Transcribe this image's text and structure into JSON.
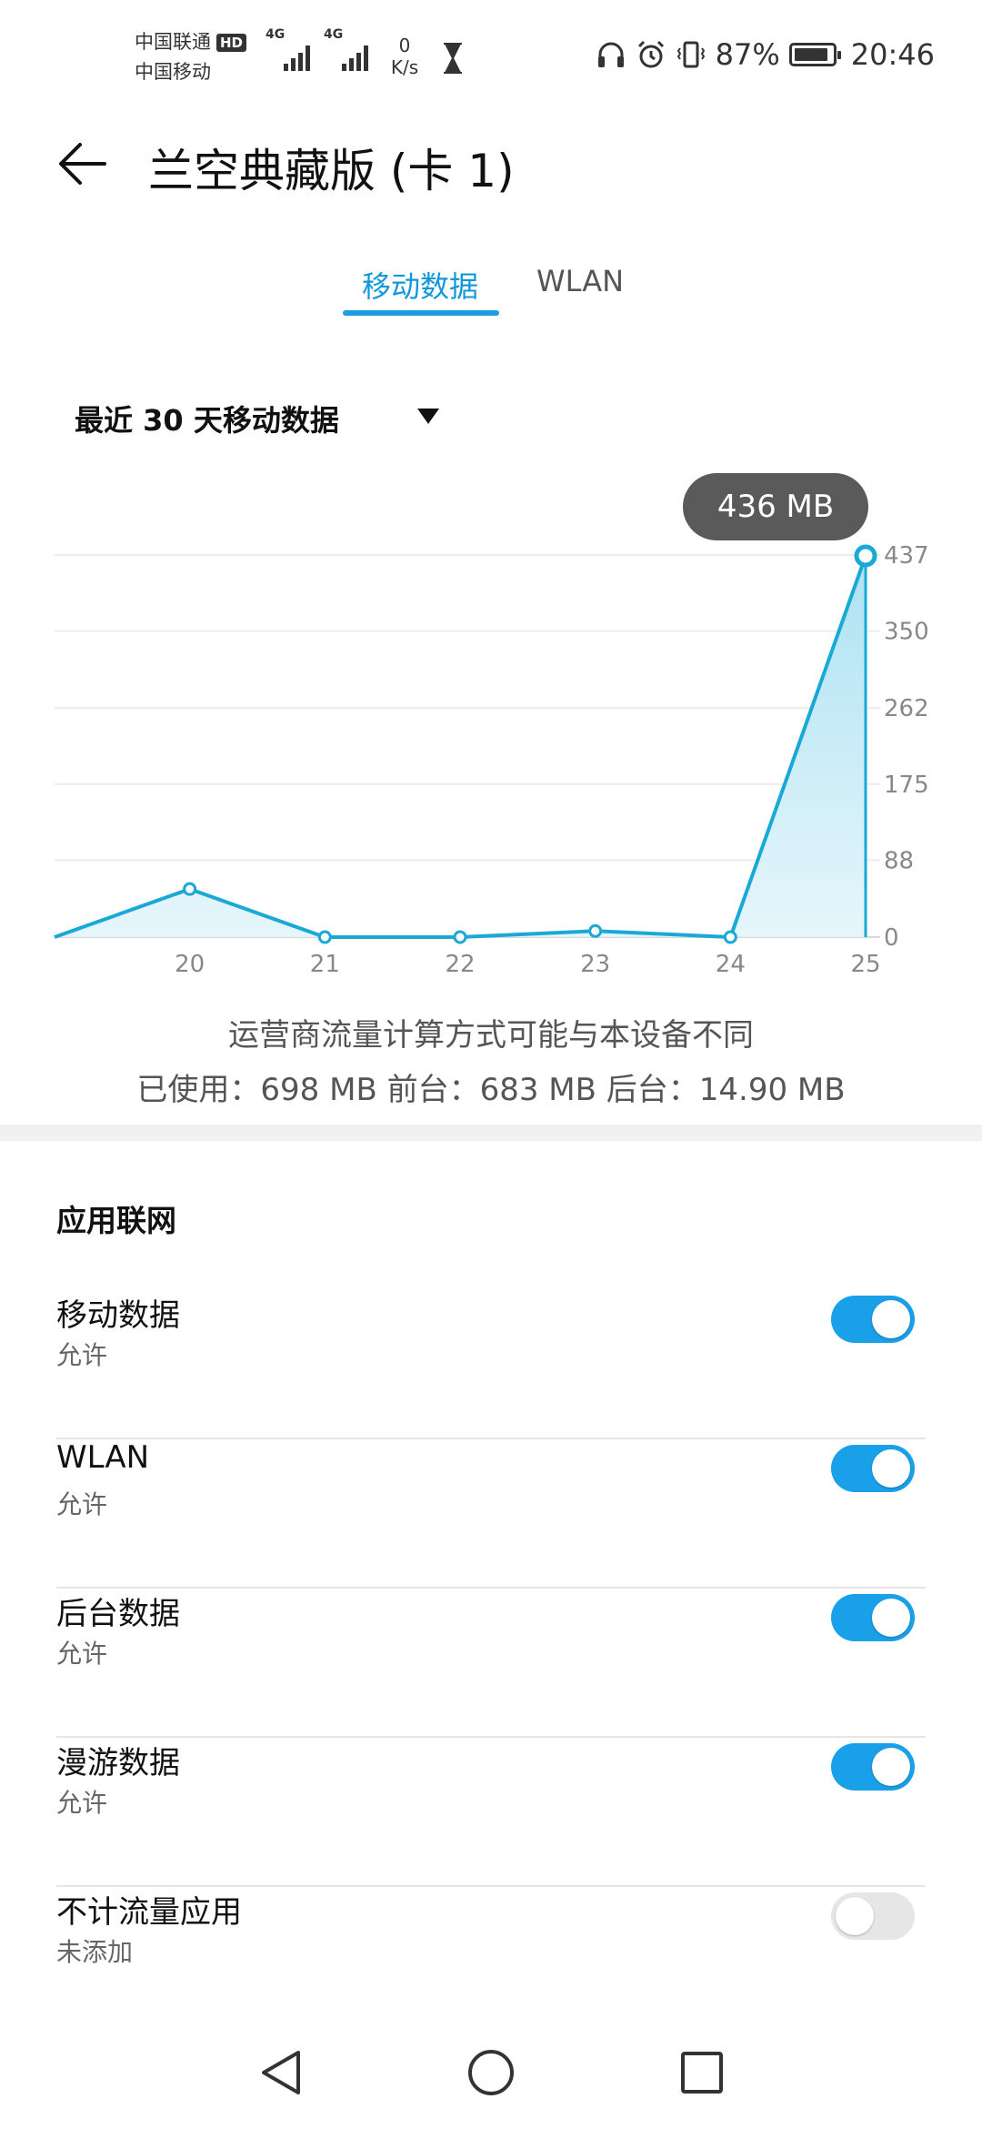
{
  "status_bar": {
    "carrier1": "中国联通",
    "hd_badge": "HD",
    "carrier2": "中国移动",
    "net1": "4G",
    "net2": "4G",
    "speed_value": "0",
    "speed_unit": "K/s",
    "battery_text": "87%",
    "time": "20:46",
    "icons": [
      "headphones-icon",
      "alarm-icon",
      "vibrate-icon",
      "battery-icon"
    ]
  },
  "header": {
    "title": "兰空典藏版 (卡 1)"
  },
  "tabs": [
    {
      "label": "移动数据",
      "active": true
    },
    {
      "label": "WLAN",
      "active": false
    }
  ],
  "range_selector": {
    "label": "最近 30 天移动数据"
  },
  "tooltip": {
    "text": "436 MB"
  },
  "chart_data": {
    "type": "area",
    "x": [
      19,
      20,
      21,
      22,
      23,
      24,
      25
    ],
    "x_tick_labels": [
      "20",
      "21",
      "22",
      "23",
      "24",
      "25"
    ],
    "values": [
      0,
      55,
      0,
      0,
      7,
      0,
      436
    ],
    "y_tick_labels": [
      "0",
      "88",
      "175",
      "262",
      "350",
      "437"
    ],
    "ylim": [
      0,
      437
    ],
    "grid": true,
    "color": "#1aa8d6",
    "fill_color": "#bfe7f5"
  },
  "notes": {
    "disclaimer": "运营商流量计算方式可能与本设备不同",
    "usage": "已使用：698 MB 前台：683 MB 后台：14.90 MB"
  },
  "app_network": {
    "section_title": "应用联网",
    "items": [
      {
        "label": "移动数据",
        "status": "允许",
        "enabled": true
      },
      {
        "label": "WLAN",
        "status": "允许",
        "enabled": true
      },
      {
        "label": "后台数据",
        "status": "允许",
        "enabled": true
      },
      {
        "label": "漫游数据",
        "status": "允许",
        "enabled": true
      },
      {
        "label": "不计流量应用",
        "status": "未添加",
        "enabled": false
      }
    ]
  },
  "nav_bar": {
    "buttons": [
      "back-icon",
      "home-icon",
      "recents-icon"
    ]
  },
  "colors": {
    "accent": "#1aa0e8",
    "toggle_off": "#e6e6e6",
    "tooltip_bg": "#5a5a5a"
  }
}
